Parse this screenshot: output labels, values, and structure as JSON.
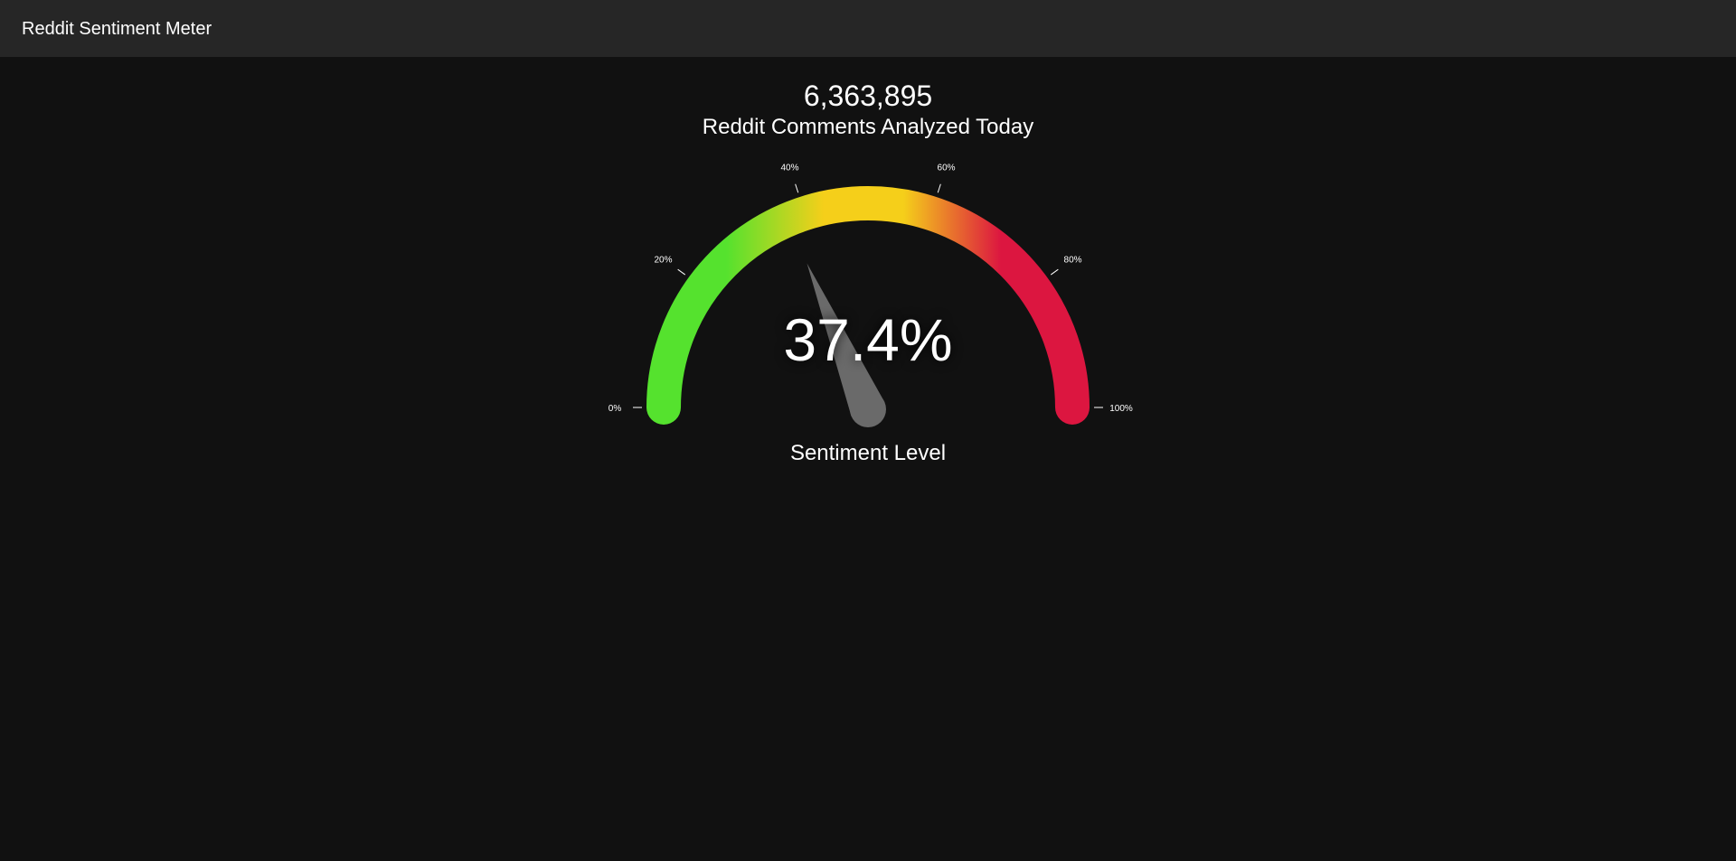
{
  "header": {
    "title": "Reddit Sentiment Meter"
  },
  "stats": {
    "comment_count": "6,363,895",
    "comment_count_label": "Reddit Comments Analyzed Today"
  },
  "gauge": {
    "value_percent": 37.4,
    "value_text": "37.4%",
    "label": "Sentiment Level",
    "ticks": [
      {
        "value": 0,
        "label": "0%"
      },
      {
        "value": 20,
        "label": "20%"
      },
      {
        "value": 40,
        "label": "40%"
      },
      {
        "value": 60,
        "label": "60%"
      },
      {
        "value": 80,
        "label": "80%"
      },
      {
        "value": 100,
        "label": "100%"
      }
    ],
    "colors": {
      "low": "#55e22e",
      "mid": "#f5cf1a",
      "high": "#dc1640",
      "needle": "#6a6a6a"
    }
  }
}
